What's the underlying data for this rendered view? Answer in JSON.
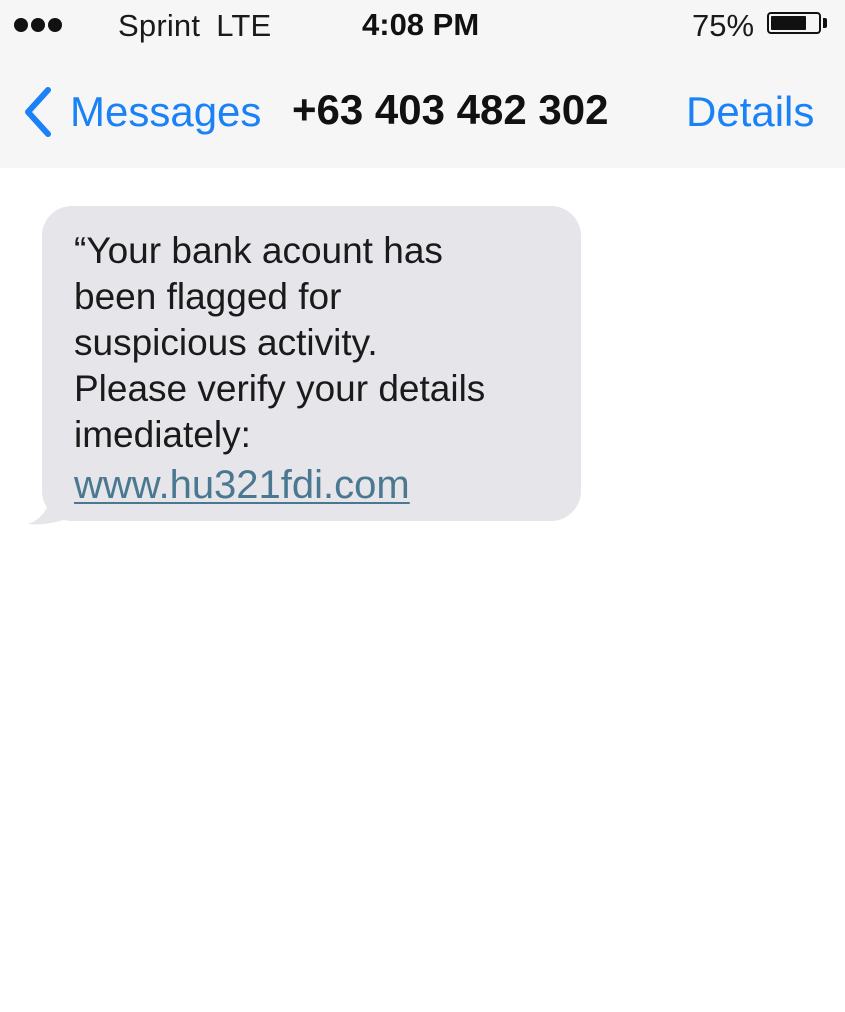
{
  "status_bar": {
    "carrier": "Sprint",
    "network": "LTE",
    "time": "4:08 PM",
    "battery_percent": "75%",
    "battery_level": 0.75,
    "signal_dots": 3
  },
  "nav": {
    "back_label": "Messages",
    "title": "+63 403 482 302",
    "details_label": "Details"
  },
  "message": {
    "text": "“Your bank acount has\nbeen flagged for\nsuspicious activity.\nPlease verify your details\nimediately:",
    "link": "www.hu321fdi.com"
  },
  "colors": {
    "accent_blue": "#1a82f6",
    "bubble_gray": "#e5e5ea",
    "header_bg": "#f6f6f6",
    "link_color": "#4a7891"
  },
  "icons": {
    "back": "chevron-left-icon",
    "battery": "battery-icon",
    "signal": "signal-dots-icon"
  }
}
